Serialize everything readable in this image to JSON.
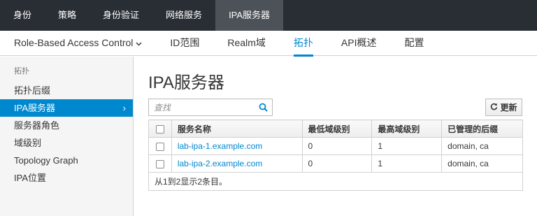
{
  "topnav": {
    "tabs": [
      {
        "label": "身份",
        "active": false
      },
      {
        "label": "策略",
        "active": false
      },
      {
        "label": "身份验证",
        "active": false
      },
      {
        "label": "网络服务",
        "active": false
      },
      {
        "label": "IPA服务器",
        "active": true
      }
    ]
  },
  "subnav": {
    "items": [
      {
        "label": "Role-Based Access Control",
        "dropdown": true,
        "active": false
      },
      {
        "label": "ID范围",
        "active": false
      },
      {
        "label": "Realm域",
        "active": false
      },
      {
        "label": "拓扑",
        "active": true
      },
      {
        "label": "API概述",
        "active": false
      },
      {
        "label": "配置",
        "active": false
      }
    ]
  },
  "sidebar": {
    "heading": "拓扑",
    "items": [
      {
        "label": "拓扑后缀",
        "active": false
      },
      {
        "label": "IPA服务器",
        "active": true
      },
      {
        "label": "服务器角色",
        "active": false
      },
      {
        "label": "域级别",
        "active": false
      },
      {
        "label": "Topology Graph",
        "active": false
      },
      {
        "label": "IPA位置",
        "active": false
      }
    ],
    "chevron": "›"
  },
  "main": {
    "title": "IPA服务器",
    "search": {
      "placeholder": "查找",
      "value": ""
    },
    "refresh_label": "更新",
    "table": {
      "columns": [
        "服务名称",
        "最低域级别",
        "最高域级别",
        "已管理的后缀"
      ],
      "rows": [
        {
          "name": "lab-ipa-1.example.com",
          "min": "0",
          "max": "1",
          "suffixes": "domain, ca"
        },
        {
          "name": "lab-ipa-2.example.com",
          "min": "0",
          "max": "1",
          "suffixes": "domain, ca"
        }
      ],
      "footer": "从1到2显示2条目。"
    }
  },
  "colors": {
    "topnav_bg": "#292e34",
    "topnav_active": "#4d5258",
    "accent": "#0088ce"
  }
}
